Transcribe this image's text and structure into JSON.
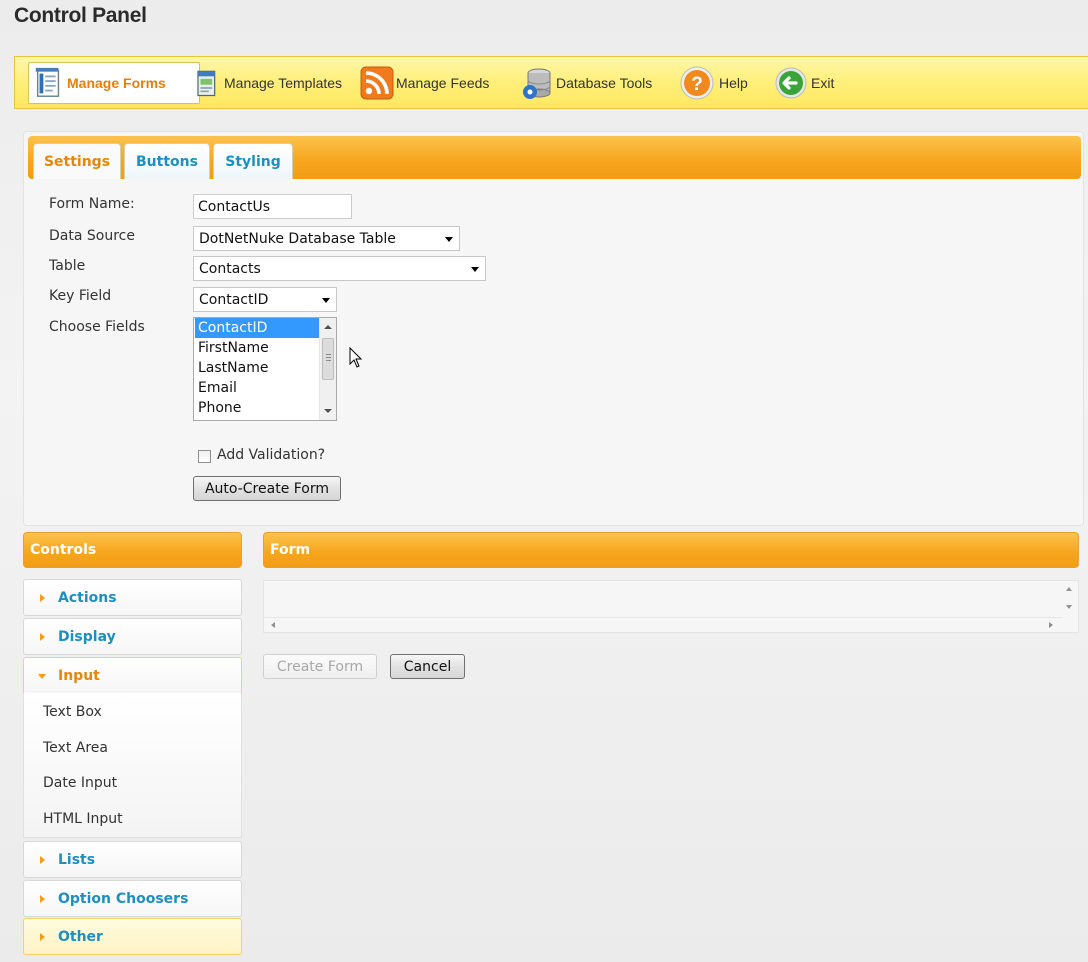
{
  "page": {
    "title": "Control Panel"
  },
  "toolbar": {
    "items": [
      {
        "label": "Manage Forms",
        "icon": "forms-icon",
        "active": true
      },
      {
        "label": "Manage Templates",
        "icon": "templates-icon"
      },
      {
        "label": "Manage Feeds",
        "icon": "rss-icon"
      },
      {
        "label": "Database Tools",
        "icon": "database-icon"
      },
      {
        "label": "Help",
        "icon": "help-icon"
      },
      {
        "label": "Exit",
        "icon": "exit-icon"
      }
    ]
  },
  "settings": {
    "tabs": [
      {
        "label": "Settings",
        "active": true
      },
      {
        "label": "Buttons"
      },
      {
        "label": "Styling"
      }
    ],
    "form_name_label": "Form Name:",
    "form_name_value": "ContactUs",
    "data_source_label": "Data Source",
    "data_source_value": "DotNetNuke Database Table",
    "table_label": "Table",
    "table_value": "Contacts",
    "key_field_label": "Key Field",
    "key_field_value": "ContactID",
    "choose_fields_label": "Choose Fields",
    "fields": [
      "ContactID",
      "FirstName",
      "LastName",
      "Email",
      "Phone"
    ],
    "selected_field": "ContactID",
    "add_validation_label": "Add Validation?",
    "add_validation_checked": false,
    "auto_create_label": "Auto-Create Form"
  },
  "controls": {
    "header": "Controls",
    "sections": [
      {
        "label": "Actions"
      },
      {
        "label": "Display"
      },
      {
        "label": "Input",
        "open": true,
        "items": [
          "Text Box",
          "Text Area",
          "Date Input",
          "HTML Input"
        ]
      },
      {
        "label": "Lists"
      },
      {
        "label": "Option Choosers"
      },
      {
        "label": "Other",
        "highlighted": true
      }
    ]
  },
  "form": {
    "header": "Form",
    "create_label": "Create Form",
    "cancel_label": "Cancel"
  },
  "colors": {
    "accent_orange": "#f7a51c",
    "toolbar_yellow": "#ffef7a",
    "link_blue": "#1e8fc0",
    "active_orange": "#e5870c"
  }
}
